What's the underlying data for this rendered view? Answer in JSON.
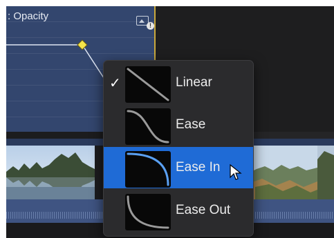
{
  "editor": {
    "title": ": Opacity",
    "icon": "keyframe-view-icon"
  },
  "menu": {
    "items": [
      {
        "label": "Linear",
        "checked": true,
        "selected": false,
        "curve": "linear"
      },
      {
        "label": "Ease",
        "checked": false,
        "selected": false,
        "curve": "ease"
      },
      {
        "label": "Ease In",
        "checked": false,
        "selected": true,
        "curve": "ease-in"
      },
      {
        "label": "Ease Out",
        "checked": false,
        "selected": false,
        "curve": "ease-out"
      }
    ],
    "check_glyph": "✓"
  },
  "colors": {
    "selection": "#1f6bd6",
    "editor_bg": "#33466e",
    "keyframe": "#f5e44a",
    "curve_highlight": "#5aa0f2"
  }
}
